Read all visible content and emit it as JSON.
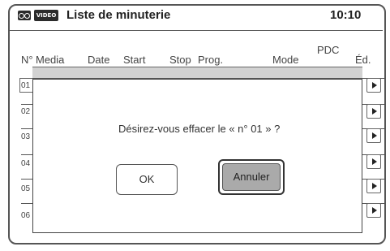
{
  "header": {
    "media_icon": "tape-icon",
    "video_badge": "VIDEO",
    "title": "Liste de minuterie",
    "time": "10:10"
  },
  "table": {
    "columns": [
      "N°",
      "Media",
      "Date",
      "Start",
      "Stop",
      "Prog.",
      "Mode",
      "PDC",
      "Éd."
    ],
    "rows": [
      "01",
      "02",
      "03",
      "04",
      "05",
      "06"
    ]
  },
  "dialog": {
    "message": "Désirez-vous effacer le « n° 01 » ?",
    "ok_label": "OK",
    "cancel_label": "Annuler"
  }
}
